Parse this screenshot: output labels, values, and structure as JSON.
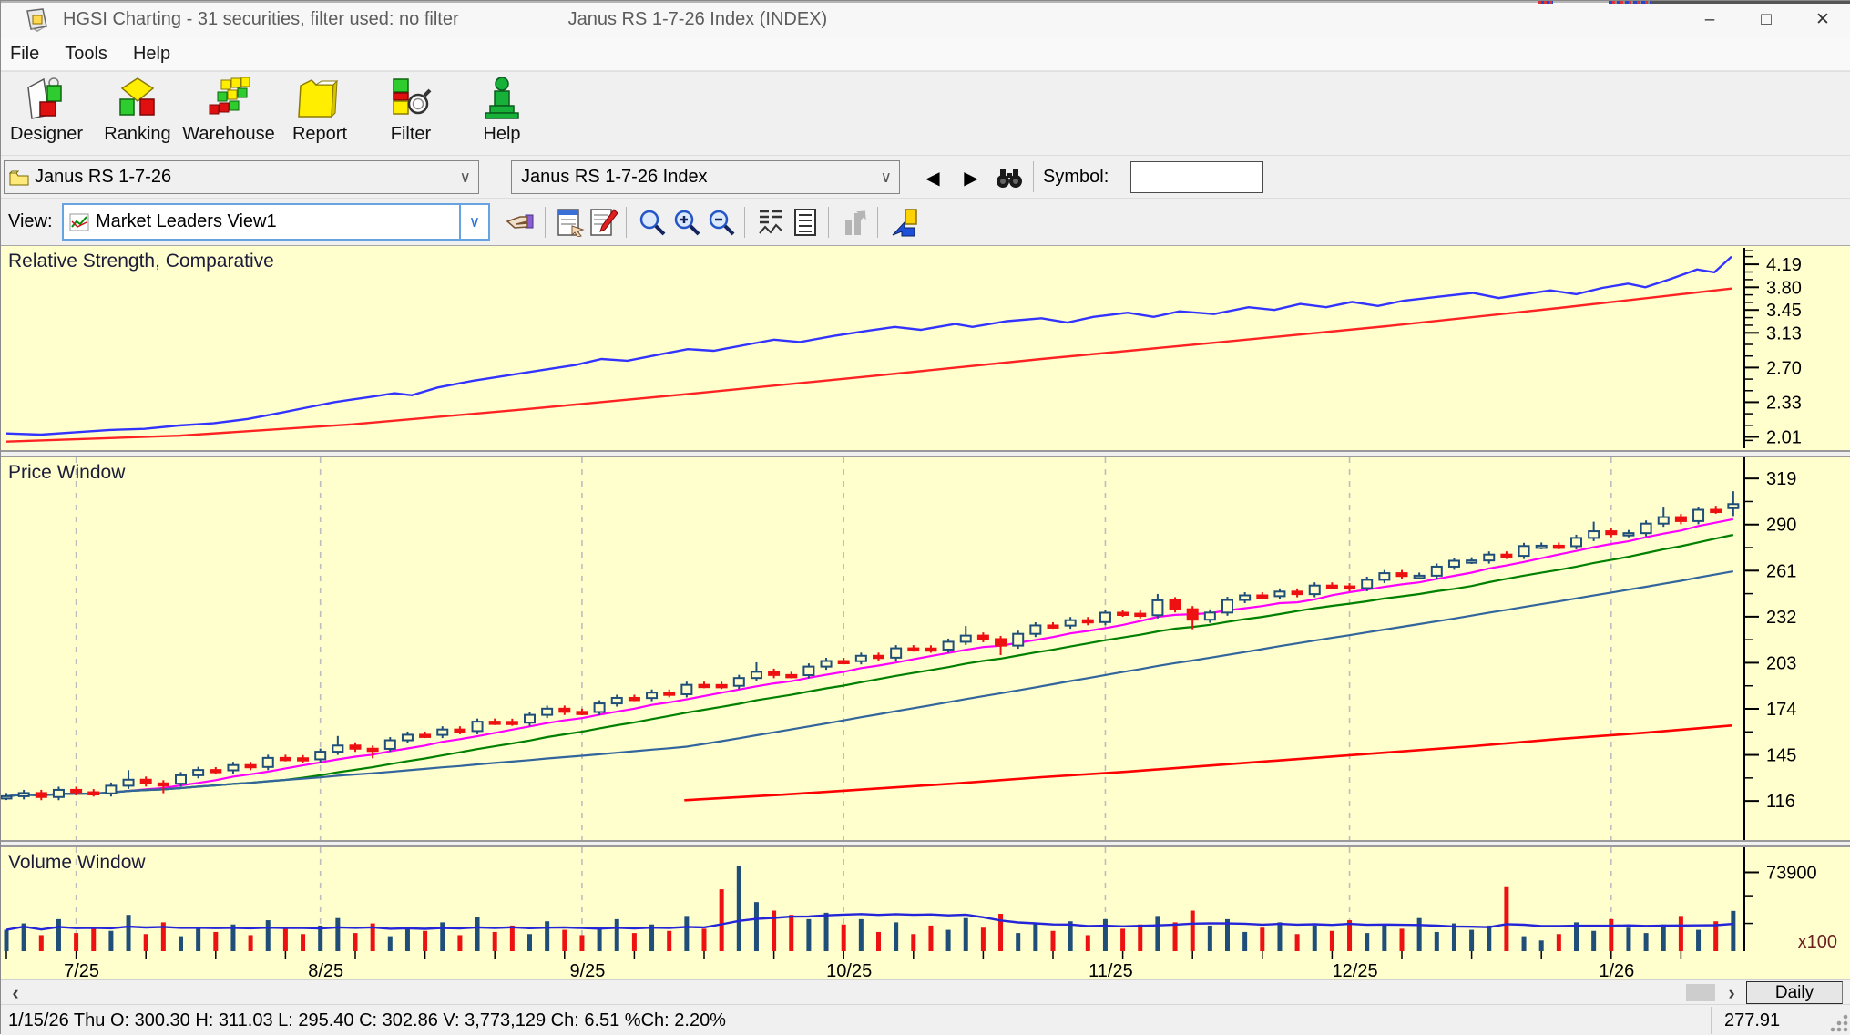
{
  "window": {
    "title_left": "HGSI Charting - 31 securities, filter used: no filter",
    "title_right": "Janus RS 1-7-26 Index (INDEX)",
    "minimize": "–",
    "maximize": "□",
    "close": "✕"
  },
  "menu": {
    "items": [
      "File",
      "Tools",
      "Help"
    ]
  },
  "toolbar": {
    "buttons": [
      {
        "label": "Designer"
      },
      {
        "label": "Ranking"
      },
      {
        "label": "Warehouse"
      },
      {
        "label": "Report"
      },
      {
        "label": "Filter"
      },
      {
        "label": "Help"
      }
    ]
  },
  "selector_row": {
    "group_combo": "Janus RS 1-7-26",
    "security_combo": "Janus RS 1-7-26 Index",
    "prev_arrow": "◀",
    "next_arrow": "▶",
    "symbol_label": "Symbol:",
    "symbol_value": ""
  },
  "view_row": {
    "label": "View:",
    "view_combo": "Market Leaders View1"
  },
  "scrollbar": {
    "left_arrow": "‹",
    "right_arrow": "›"
  },
  "timeframe_button": "Daily",
  "status_bar": {
    "left": "1/15/26 Thu O: 300.30 H: 311.03 L: 295.40 C: 302.86 V: 3,773,129 Ch: 6.51 %Ch: 2.20%",
    "right": "277.91"
  },
  "colors": {
    "chart_bg": "#ffffce",
    "axis": "#000000",
    "grid": "#bdbdbd",
    "candle_up": "#1F4E79",
    "candle_down": "#EE1111",
    "rs_fast": "#3333ff",
    "rs_slow": "#ff2222",
    "ma_fast": "#ff00ff",
    "ma_mid": "#008000",
    "ma_slow": "#31659C",
    "ma_long": "#ff0000",
    "volume_ma": "#2424d8",
    "unit_label_color": "#6b2020"
  },
  "chart_data": {
    "type": "candlestick-multi-panel",
    "months": [
      {
        "label": "7/25",
        "index": 4
      },
      {
        "label": "8/25",
        "index": 18
      },
      {
        "label": "9/25",
        "index": 33
      },
      {
        "label": "10/25",
        "index": 48
      },
      {
        "label": "11/25",
        "index": 63
      },
      {
        "label": "12/25",
        "index": 77
      },
      {
        "label": "1/26",
        "index": 92
      }
    ],
    "rs": {
      "title": "Relative Strength, Comparative",
      "ylim": [
        1.96,
        4.46
      ],
      "ticks": [
        4.19,
        3.8,
        3.45,
        3.13,
        2.7,
        2.33,
        2.01
      ],
      "series": [
        {
          "name": "security-rs",
          "color": "#3333ff",
          "points": [
            [
              0,
              2.04
            ],
            [
              0.02,
              2.03
            ],
            [
              0.04,
              2.05
            ],
            [
              0.06,
              2.07
            ],
            [
              0.08,
              2.08
            ],
            [
              0.1,
              2.11
            ],
            [
              0.12,
              2.13
            ],
            [
              0.14,
              2.17
            ],
            [
              0.16,
              2.23
            ],
            [
              0.175,
              2.28
            ],
            [
              0.19,
              2.33
            ],
            [
              0.21,
              2.38
            ],
            [
              0.225,
              2.42
            ],
            [
              0.235,
              2.4
            ],
            [
              0.25,
              2.48
            ],
            [
              0.27,
              2.55
            ],
            [
              0.29,
              2.61
            ],
            [
              0.31,
              2.67
            ],
            [
              0.33,
              2.73
            ],
            [
              0.345,
              2.8
            ],
            [
              0.36,
              2.78
            ],
            [
              0.38,
              2.86
            ],
            [
              0.395,
              2.92
            ],
            [
              0.41,
              2.9
            ],
            [
              0.43,
              2.98
            ],
            [
              0.445,
              3.04
            ],
            [
              0.46,
              3.01
            ],
            [
              0.48,
              3.09
            ],
            [
              0.5,
              3.16
            ],
            [
              0.515,
              3.21
            ],
            [
              0.53,
              3.17
            ],
            [
              0.55,
              3.25
            ],
            [
              0.56,
              3.21
            ],
            [
              0.58,
              3.29
            ],
            [
              0.6,
              3.33
            ],
            [
              0.615,
              3.27
            ],
            [
              0.63,
              3.35
            ],
            [
              0.65,
              3.41
            ],
            [
              0.665,
              3.35
            ],
            [
              0.68,
              3.43
            ],
            [
              0.7,
              3.39
            ],
            [
              0.72,
              3.49
            ],
            [
              0.735,
              3.45
            ],
            [
              0.75,
              3.54
            ],
            [
              0.765,
              3.49
            ],
            [
              0.78,
              3.57
            ],
            [
              0.795,
              3.51
            ],
            [
              0.81,
              3.59
            ],
            [
              0.83,
              3.65
            ],
            [
              0.85,
              3.71
            ],
            [
              0.865,
              3.63
            ],
            [
              0.88,
              3.69
            ],
            [
              0.895,
              3.75
            ],
            [
              0.91,
              3.69
            ],
            [
              0.925,
              3.79
            ],
            [
              0.94,
              3.86
            ],
            [
              0.95,
              3.8
            ],
            [
              0.965,
              3.94
            ],
            [
              0.98,
              4.1
            ],
            [
              0.99,
              4.05
            ],
            [
              1,
              4.33
            ]
          ]
        },
        {
          "name": "benchmark-rs",
          "color": "#ff2222",
          "points": [
            [
              0,
              1.97
            ],
            [
              0.1,
              2.02
            ],
            [
              0.2,
              2.12
            ],
            [
              0.3,
              2.26
            ],
            [
              0.4,
              2.42
            ],
            [
              0.5,
              2.6
            ],
            [
              0.6,
              2.8
            ],
            [
              0.7,
              3.0
            ],
            [
              0.8,
              3.22
            ],
            [
              0.9,
              3.48
            ],
            [
              1,
              3.78
            ]
          ]
        }
      ]
    },
    "price": {
      "title": "Price Window",
      "ylim": [
        96,
        330
      ],
      "ticks": [
        319,
        290,
        261,
        232,
        203,
        174,
        145,
        116
      ],
      "moving_averages": [
        {
          "name": "ma-fast",
          "period": 8,
          "color": "#ff00ff"
        },
        {
          "name": "ma-mid",
          "period": 17,
          "color": "#008000"
        },
        {
          "name": "ma-slow",
          "period": 40,
          "color": "#31659C"
        }
      ],
      "long_ma": {
        "name": "ma-long",
        "color": "#ff0000",
        "points": [
          [
            0.393,
            116.5
          ],
          [
            0.45,
            120
          ],
          [
            0.5,
            123.5
          ],
          [
            0.55,
            127
          ],
          [
            0.6,
            131
          ],
          [
            0.65,
            134.5
          ],
          [
            0.7,
            138.5
          ],
          [
            0.75,
            142.5
          ],
          [
            0.8,
            146.5
          ],
          [
            0.85,
            150.5
          ],
          [
            0.9,
            155
          ],
          [
            0.95,
            159
          ],
          [
            1,
            163.5
          ]
        ]
      },
      "candles": [
        [
          118.6,
          121.0,
          116.6,
          119.0
        ],
        [
          119.0,
          123.0,
          117.0,
          121.0
        ],
        [
          121.0,
          123.0,
          116.5,
          118.5
        ],
        [
          118.5,
          125.0,
          116.5,
          123.0
        ],
        [
          123.0,
          125.0,
          119.5,
          121.5
        ],
        [
          121.5,
          123.5,
          118.8,
          120.8
        ],
        [
          120.8,
          127.6,
          118.8,
          125.6
        ],
        [
          125.6,
          135.4,
          123.6,
          129.4
        ],
        [
          129.4,
          131.4,
          125.1,
          127.1
        ],
        [
          127.1,
          129.1,
          120.9,
          126.9
        ],
        [
          126.9,
          134.2,
          124.9,
          132.2
        ],
        [
          132.2,
          137.5,
          130.2,
          135.5
        ],
        [
          135.5,
          137.3,
          133.3,
          135.3
        ],
        [
          135.3,
          140.6,
          133.3,
          138.6
        ],
        [
          138.6,
          140.6,
          135.4,
          137.4
        ],
        [
          137.4,
          145.1,
          135.4,
          143.1
        ],
        [
          143.1,
          145.1,
          140.9,
          142.9
        ],
        [
          142.9,
          144.9,
          140.2,
          142.2
        ],
        [
          142.2,
          149.0,
          140.2,
          147.0
        ],
        [
          147.0,
          156.9,
          145.0,
          150.9
        ],
        [
          150.9,
          152.9,
          146.9,
          148.9
        ],
        [
          148.9,
          150.9,
          142.8,
          148.8
        ],
        [
          148.8,
          156.2,
          146.8,
          154.2
        ],
        [
          154.2,
          159.7,
          152.2,
          157.7
        ],
        [
          157.7,
          159.7,
          155.6,
          157.6
        ],
        [
          157.6,
          163.0,
          155.6,
          161.0
        ],
        [
          161.0,
          163.0,
          158.0,
          160.0
        ],
        [
          160.0,
          167.9,
          158.0,
          165.9
        ],
        [
          165.9,
          167.9,
          163.8,
          165.8
        ],
        [
          165.8,
          167.8,
          163.3,
          165.3
        ],
        [
          165.3,
          172.2,
          163.3,
          170.2
        ],
        [
          170.2,
          176.1,
          168.2,
          174.1
        ],
        [
          174.1,
          176.1,
          170.1,
          172.1
        ],
        [
          172.1,
          174.1,
          170.0,
          172.0
        ],
        [
          172.0,
          179.4,
          170.0,
          177.4
        ],
        [
          177.4,
          182.9,
          175.4,
          180.9
        ],
        [
          180.9,
          182.9,
          178.8,
          180.8
        ],
        [
          180.8,
          186.2,
          178.8,
          184.2
        ],
        [
          184.2,
          186.2,
          181.2,
          183.2
        ],
        [
          183.2,
          191.1,
          181.2,
          189.1
        ],
        [
          189.1,
          191.1,
          187.0,
          189.0
        ],
        [
          189.0,
          191.0,
          186.5,
          188.5
        ],
        [
          188.5,
          195.4,
          186.5,
          193.4
        ],
        [
          193.4,
          203.3,
          191.4,
          197.3
        ],
        [
          197.3,
          199.3,
          193.3,
          195.3
        ],
        [
          195.3,
          197.3,
          193.2,
          195.2
        ],
        [
          195.2,
          202.6,
          193.2,
          200.6
        ],
        [
          200.6,
          206.1,
          198.6,
          204.1
        ],
        [
          204.1,
          206.1,
          202.0,
          204.0
        ],
        [
          204.0,
          209.4,
          202.0,
          207.4
        ],
        [
          207.4,
          209.4,
          204.2,
          206.2
        ],
        [
          206.2,
          214.1,
          204.2,
          212.1
        ],
        [
          212.1,
          214.1,
          210.0,
          212.0
        ],
        [
          212.0,
          214.0,
          209.3,
          211.3
        ],
        [
          211.3,
          218.2,
          209.3,
          216.2
        ],
        [
          216.2,
          226.1,
          214.2,
          220.1
        ],
        [
          220.1,
          222.1,
          215.9,
          217.9
        ],
        [
          217.9,
          219.9,
          207.8,
          213.8
        ],
        [
          213.8,
          223.2,
          211.8,
          221.2
        ],
        [
          221.2,
          228.5,
          219.2,
          226.5
        ],
        [
          226.5,
          228.5,
          224.4,
          226.4
        ],
        [
          226.4,
          231.8,
          224.4,
          229.8
        ],
        [
          229.8,
          231.8,
          226.6,
          228.6
        ],
        [
          228.6,
          236.5,
          226.6,
          234.5
        ],
        [
          234.5,
          236.5,
          231.9,
          233.9
        ],
        [
          233.9,
          235.9,
          230.9,
          232.9
        ],
        [
          232.9,
          246.3,
          230.9,
          242.3
        ],
        [
          242.3,
          244.3,
          234.7,
          236.7
        ],
        [
          236.7,
          238.7,
          224.1,
          230.1
        ],
        [
          230.1,
          236.6,
          228.1,
          234.6
        ],
        [
          234.6,
          244.5,
          232.6,
          242.5
        ],
        [
          242.5,
          247.4,
          240.5,
          245.4
        ],
        [
          245.4,
          247.4,
          242.9,
          244.9
        ],
        [
          244.9,
          249.8,
          242.9,
          247.8
        ],
        [
          247.8,
          249.8,
          244.2,
          246.2
        ],
        [
          246.2,
          253.6,
          244.2,
          251.6
        ],
        [
          251.6,
          253.6,
          249.1,
          251.1
        ],
        [
          251.1,
          253.1,
          248.0,
          250.0
        ],
        [
          250.0,
          257.2,
          248.0,
          255.2
        ],
        [
          255.2,
          261.4,
          253.2,
          259.4
        ],
        [
          259.4,
          261.4,
          255.6,
          257.6
        ],
        [
          257.6,
          259.8,
          255.6,
          257.8
        ],
        [
          257.8,
          265.5,
          255.8,
          263.5
        ],
        [
          263.5,
          269.2,
          261.5,
          267.2
        ],
        [
          267.2,
          269.4,
          265.2,
          267.4
        ],
        [
          267.4,
          273.1,
          265.4,
          271.1
        ],
        [
          271.1,
          273.1,
          268.3,
          270.3
        ],
        [
          270.3,
          278.5,
          268.3,
          276.5
        ],
        [
          276.5,
          278.7,
          274.5,
          276.7
        ],
        [
          276.7,
          278.7,
          274.4,
          276.4
        ],
        [
          276.4,
          283.6,
          274.4,
          281.6
        ],
        [
          281.6,
          291.8,
          279.6,
          285.8
        ],
        [
          285.8,
          287.8,
          282.0,
          284.0
        ],
        [
          284.0,
          286.6,
          282.0,
          284.6
        ],
        [
          284.6,
          292.6,
          282.6,
          290.6
        ],
        [
          290.6,
          300.7,
          288.6,
          294.7
        ],
        [
          294.7,
          296.7,
          290.2,
          292.2
        ],
        [
          292.2,
          301.3,
          290.2,
          299.3
        ],
        [
          299.3,
          301.8,
          296.8,
          298.8
        ],
        [
          300.3,
          311.0,
          295.4,
          302.9
        ]
      ]
    },
    "volume": {
      "title": "Volume Window",
      "ylim": [
        0,
        82000
      ],
      "tick_label": "73900",
      "tick_value": 73900,
      "minor_ticks": [
        52000,
        26000
      ],
      "unit_label": "x100",
      "ma_period": 15,
      "values": [
        20000,
        26000,
        15000,
        30000,
        17000,
        23000,
        19000,
        34000,
        16000,
        27000,
        14000,
        22000,
        18000,
        25000,
        15000,
        29000,
        21000,
        16000,
        24000,
        31000,
        17000,
        26000,
        14000,
        23000,
        19000,
        27000,
        15000,
        32000,
        18000,
        24000,
        16000,
        28000,
        20000,
        15000,
        22000,
        30000,
        17000,
        25000,
        19000,
        33000,
        21000,
        58000,
        80000,
        46000,
        38000,
        34000,
        30000,
        36000,
        25000,
        30000,
        18000,
        27000,
        16000,
        24000,
        20000,
        31000,
        22000,
        35000,
        17000,
        26000,
        19000,
        28000,
        15000,
        30000,
        21000,
        25000,
        33000,
        27000,
        38000,
        24000,
        30000,
        18000,
        22000,
        27000,
        16000,
        24000,
        19000,
        29000,
        17000,
        25000,
        21000,
        31000,
        18000,
        26000,
        20000,
        24000,
        60000,
        14000,
        10000,
        16000,
        27000,
        19000,
        30000,
        22000,
        17000,
        25000,
        33000,
        20000,
        28000,
        37731
      ]
    }
  }
}
